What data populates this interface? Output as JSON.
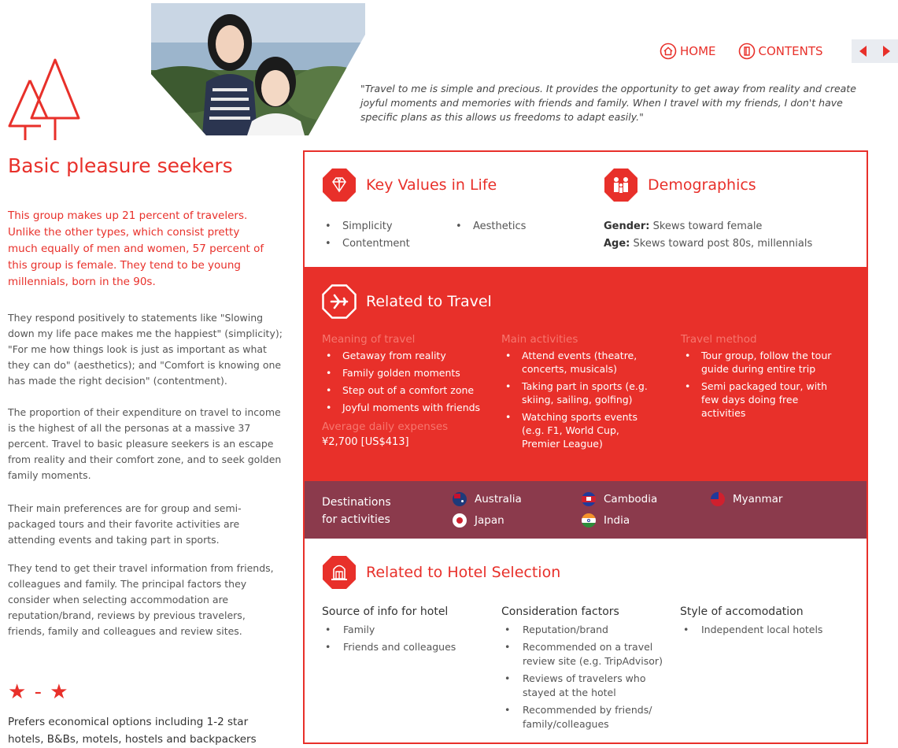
{
  "nav": {
    "home_label": "HOME",
    "contents_label": "CONTENTS"
  },
  "quote": "\"Travel to me is simple and precious. It provides the opportunity to get away from reality and create joyful moments and memories with friends and family. When I travel with my friends, I don't have specific plans as this allows us freedoms to adapt easily.\"",
  "left": {
    "title": "Basic pleasure seekers",
    "intro": "This group makes up 21 percent of travelers. Unlike the other types, which consist pretty much equally of men and women, 57 percent of this group is female. They tend to be young millennials, born in the 90s.",
    "paragraphs": [
      "They respond positively to statements like \"Slowing down my life pace makes me the happiest\" (simplicity); \"For me how things look is just as important as what they can do\" (aesthetics); and \"Comfort is knowing one has made the right decision\" (contentment).",
      "The proportion of their expenditure on travel to income is the highest of all the personas at a massive 37 percent. Travel to basic pleasure seekers is an escape from reality and their comfort zone, and to seek golden family moments.",
      "Their main preferences are for group and semi-packaged tours and their favorite activities are attending events and taking part in sports.",
      "They tend to get their travel information from friends, colleagues and family. The principal factors they consider when selecting accommodation are reputation/brand, reviews by previous travelers, friends, family and colleagues and review sites."
    ],
    "stars": "★ - ★",
    "star_note": "Prefers economical options including 1-2 star hotels, B&Bs, motels, hostels and backpackers"
  },
  "values": {
    "heading": "Key Values in Life",
    "col1": [
      "Simplicity",
      "Contentment"
    ],
    "col2": [
      "Aesthetics"
    ]
  },
  "demographics": {
    "heading": "Demographics",
    "gender_label": "Gender:",
    "gender_value": " Skews toward female",
    "age_label": "Age:",
    "age_value": " Skews toward post 80s, millennials"
  },
  "travel": {
    "heading": "Related to Travel",
    "meaning_title": "Meaning of travel",
    "meaning": [
      "Getaway from reality",
      "Family golden moments",
      "Step out of a comfort zone",
      "Joyful moments with friends"
    ],
    "expense_title": "Average daily expenses",
    "expense_value": "¥2,700 [US$413]",
    "activities_title": "Main activities",
    "activities": [
      "Attend events (theatre, concerts, musicals)",
      "Taking part in sports (e.g. skiing, sailing, golfing)",
      "Watching sports events (e.g. F1, World Cup, Premier League)"
    ],
    "method_title": "Travel method",
    "method": [
      "Tour group, follow the tour guide during entire trip",
      "Semi packaged tour, with few days doing free activities"
    ]
  },
  "destinations": {
    "label_line1": "Destinations",
    "label_line2": "for activities",
    "countries": [
      "Australia",
      "Cambodia",
      "Myanmar",
      "Japan",
      "India"
    ]
  },
  "hotel": {
    "heading": "Related to Hotel Selection",
    "source_title": "Source of info for hotel",
    "source": [
      "Family",
      "Friends and colleagues"
    ],
    "factors_title": "Consideration factors",
    "factors": [
      "Reputation/brand",
      "Recommended on a travel review site (e.g. TripAdvisor)",
      "Reviews of travelers who stayed at the hotel",
      "Recommended by friends/ family/colleagues"
    ],
    "style_title": "Style of accomodation",
    "style": [
      "Independent local hotels"
    ]
  },
  "colors": {
    "accent": "#e8302a",
    "destinations_band": "#8b3a4c"
  }
}
